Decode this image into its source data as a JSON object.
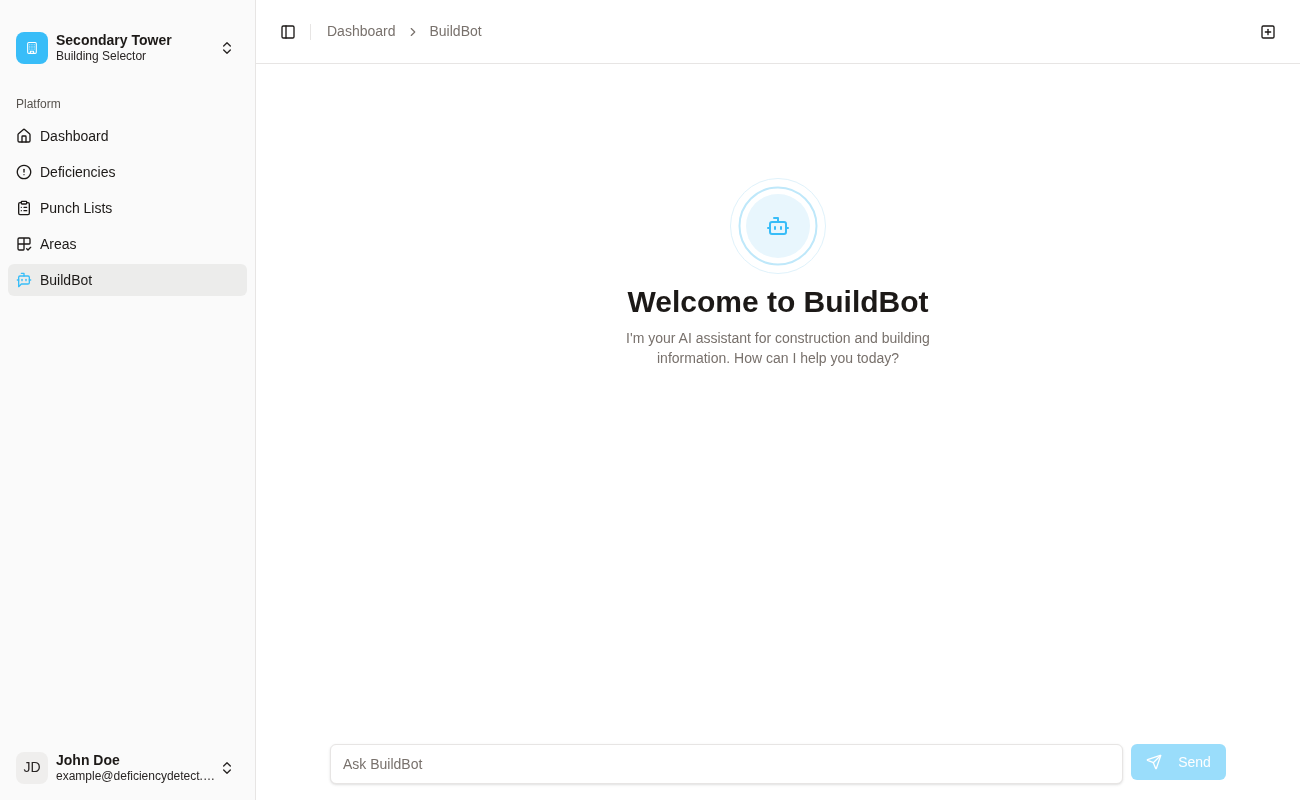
{
  "sidebar": {
    "building": {
      "name": "Secondary Tower",
      "subtitle": "Building Selector"
    },
    "group_label": "Platform",
    "items": [
      {
        "label": "Dashboard",
        "kind": "home",
        "selected": false
      },
      {
        "label": "Deficiencies",
        "kind": "alert",
        "selected": false
      },
      {
        "label": "Punch Lists",
        "kind": "clipboard",
        "selected": false
      },
      {
        "label": "Areas",
        "kind": "grid",
        "selected": false
      },
      {
        "label": "BuildBot",
        "kind": "bot",
        "selected": true
      }
    ],
    "user": {
      "initials": "JD",
      "name": "John Doe",
      "email": "example@deficiencydetect.…"
    }
  },
  "header": {
    "breadcrumb": [
      {
        "label": "Dashboard"
      },
      {
        "label": "BuildBot"
      }
    ]
  },
  "welcome": {
    "title": "Welcome to BuildBot",
    "message": "I'm your AI assistant for construction and building information. How can I help you today?"
  },
  "composer": {
    "placeholder": "Ask BuildBot",
    "send_label": "Send",
    "send_disabled": true
  }
}
